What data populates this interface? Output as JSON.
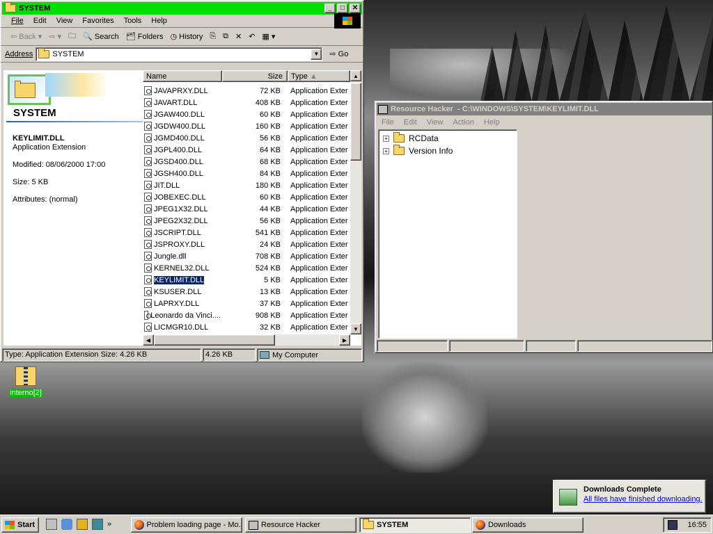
{
  "explorer": {
    "title": "SYSTEM",
    "menu": [
      "File",
      "Edit",
      "View",
      "Favorites",
      "Tools",
      "Help"
    ],
    "toolbar": {
      "back": "Back",
      "search": "Search",
      "folders": "Folders",
      "history": "History"
    },
    "address_label": "Address",
    "address_value": "SYSTEM",
    "go_label": "Go",
    "left_panel": {
      "folder_title": "SYSTEM",
      "file_name": "KEYLIMIT.DLL",
      "file_type": "Application Extension",
      "modified": "Modified: 08/06/2000 17:00",
      "size": "Size: 5 KB",
      "attributes": "Attributes: (normal)"
    },
    "columns": {
      "name": "Name",
      "size": "Size",
      "type": "Type"
    },
    "files": [
      {
        "name": "JAVAPRXY.DLL",
        "size": "72 KB",
        "type": "Application Exter"
      },
      {
        "name": "JAVART.DLL",
        "size": "408 KB",
        "type": "Application Exter"
      },
      {
        "name": "JGAW400.DLL",
        "size": "60 KB",
        "type": "Application Exter"
      },
      {
        "name": "JGDW400.DLL",
        "size": "160 KB",
        "type": "Application Exter"
      },
      {
        "name": "JGMD400.DLL",
        "size": "56 KB",
        "type": "Application Exter"
      },
      {
        "name": "JGPL400.DLL",
        "size": "64 KB",
        "type": "Application Exter"
      },
      {
        "name": "JGSD400.DLL",
        "size": "68 KB",
        "type": "Application Exter"
      },
      {
        "name": "JGSH400.DLL",
        "size": "84 KB",
        "type": "Application Exter"
      },
      {
        "name": "JIT.DLL",
        "size": "180 KB",
        "type": "Application Exter"
      },
      {
        "name": "JOBEXEC.DLL",
        "size": "60 KB",
        "type": "Application Exter"
      },
      {
        "name": "JPEG1X32.DLL",
        "size": "44 KB",
        "type": "Application Exter"
      },
      {
        "name": "JPEG2X32.DLL",
        "size": "56 KB",
        "type": "Application Exter"
      },
      {
        "name": "JSCRIPT.DLL",
        "size": "541 KB",
        "type": "Application Exter"
      },
      {
        "name": "JSPROXY.DLL",
        "size": "24 KB",
        "type": "Application Exter"
      },
      {
        "name": "Jungle.dll",
        "size": "708 KB",
        "type": "Application Exter"
      },
      {
        "name": "KERNEL32.DLL",
        "size": "524 KB",
        "type": "Application Exter"
      },
      {
        "name": "KEYLIMIT.DLL",
        "size": "5 KB",
        "type": "Application Exter"
      },
      {
        "name": "KSUSER.DLL",
        "size": "13 KB",
        "type": "Application Exter"
      },
      {
        "name": "LAPRXY.DLL",
        "size": "37 KB",
        "type": "Application Exter"
      },
      {
        "name": "Leonardo da Vinci....",
        "size": "908 KB",
        "type": "Application Exter"
      },
      {
        "name": "LICMGR10.DLL",
        "size": "32 KB",
        "type": "Application Exter"
      }
    ],
    "status": {
      "left": "Type: Application Extension Size: 4.26 KB",
      "mid": "4.26 KB",
      "right": "My Computer"
    }
  },
  "reshacker": {
    "title": "Resource Hacker  - C:\\WINDOWS\\SYSTEM\\KEYLIMIT.DLL",
    "menu": [
      "File",
      "Edit",
      "View",
      "Action",
      "Help"
    ],
    "tree": [
      "RCData",
      "Version Info"
    ]
  },
  "desktop_icon": "interno[2]",
  "download": {
    "title": "Downloads Complete",
    "link": "All files have finished downloading."
  },
  "taskbar": {
    "start": "Start",
    "tasks": [
      "Problem loading page - Mo...",
      "Resource Hacker",
      "SYSTEM",
      "Downloads"
    ],
    "clock": "16:55"
  },
  "colors": {
    "explorer_title": "#00e000",
    "reshacker_title": "#808080",
    "selection": "#0a246a",
    "desktop_icon_label": "#00c000"
  }
}
